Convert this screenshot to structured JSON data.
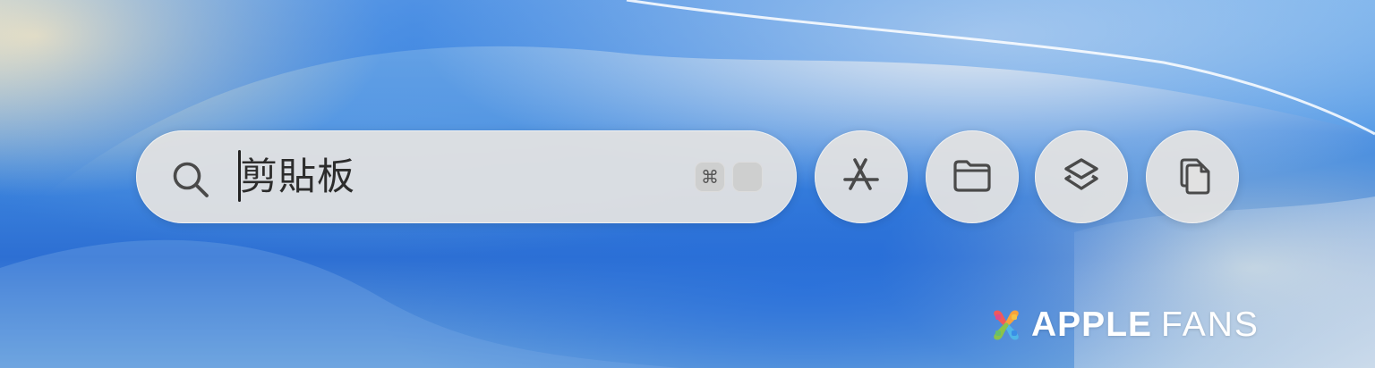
{
  "search": {
    "query": "剪貼板",
    "icon": "search-icon",
    "shortcut_key": "⌘"
  },
  "quick_actions": [
    {
      "icon": "app-store-icon"
    },
    {
      "icon": "folder-icon"
    },
    {
      "icon": "shortcuts-icon"
    },
    {
      "icon": "clipboard-icon"
    }
  ],
  "watermark": {
    "bold_text": "APPLE",
    "light_text": "FANS",
    "logo_icon": "apple-fans-logo"
  },
  "colors": {
    "bar_bg": "#e1e1e1",
    "icon_color": "#4a4a4a",
    "watermark_text": "#ffffff"
  }
}
